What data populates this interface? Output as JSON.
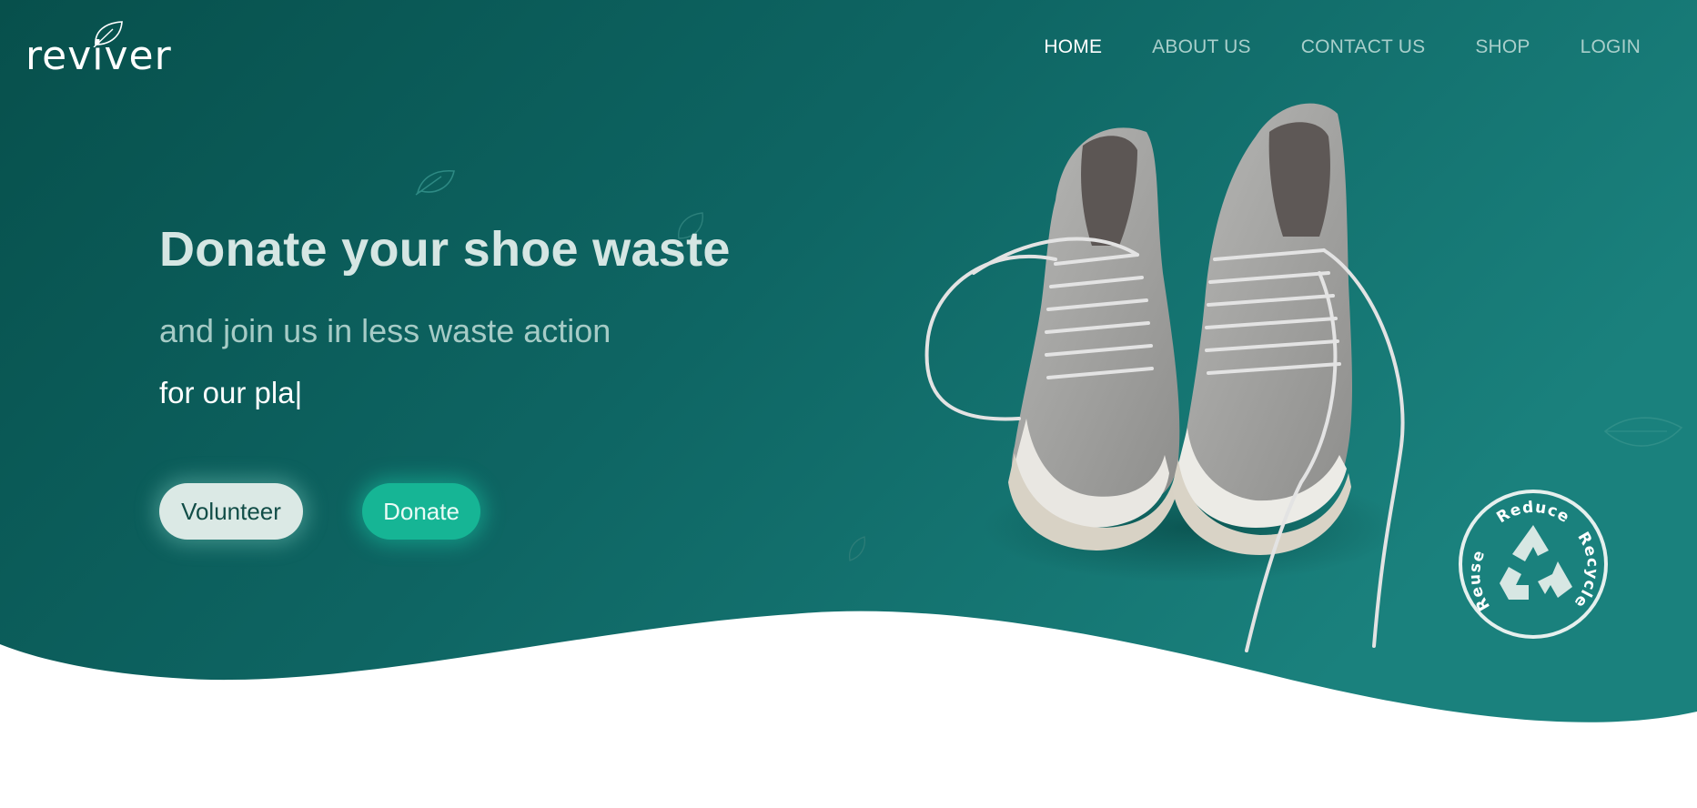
{
  "brand": {
    "name": "reviver"
  },
  "nav": {
    "items": [
      {
        "label": "HOME",
        "active": true
      },
      {
        "label": "ABOUT US",
        "active": false
      },
      {
        "label": "CONTACT US",
        "active": false
      },
      {
        "label": "SHOP",
        "active": false
      },
      {
        "label": "LOGIN",
        "active": false
      }
    ]
  },
  "hero": {
    "headline": "Donate your shoe waste",
    "subline": "and join us in less waste action",
    "typed_text": "for our pla",
    "cursor": "|",
    "buttons": {
      "volunteer": "Volunteer",
      "donate": "Donate"
    },
    "image": {
      "icon": "sneakers-illustration"
    }
  },
  "badge": {
    "top_word": "Reduce",
    "right_word": "Recycle",
    "left_word": "Reuse",
    "icon": "recycle-icon"
  },
  "colors": {
    "bg_dark": "#09534f",
    "bg_light": "#1a807b",
    "accent": "#16b595",
    "light_button": "#dbe9e5",
    "headline": "#d5e6e3"
  }
}
